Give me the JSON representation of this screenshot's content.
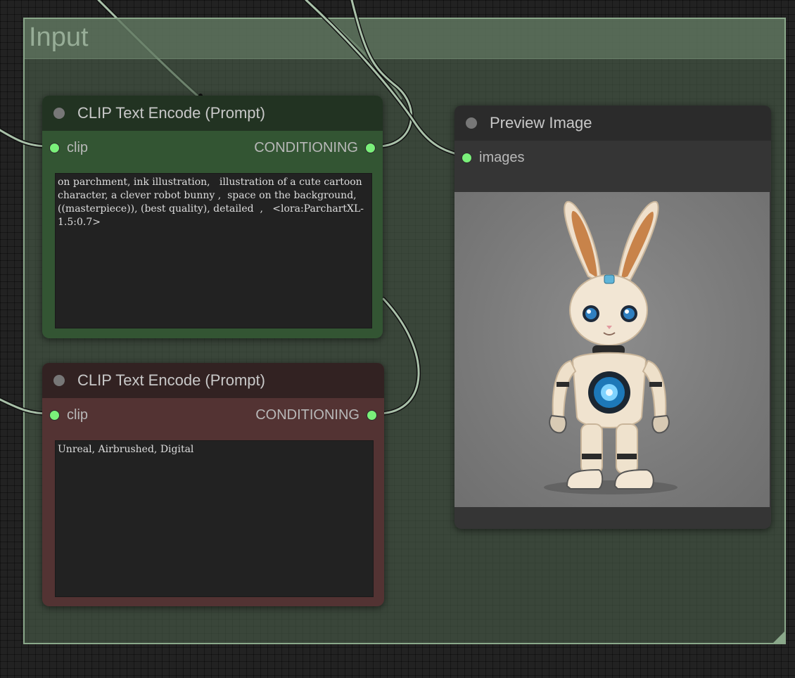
{
  "group": {
    "title": "Input"
  },
  "nodes": {
    "positive": {
      "title": "CLIP Text Encode (Prompt)",
      "input_label": "clip",
      "output_label": "CONDITIONING",
      "text": "on parchment, ink illustration,   illustration of a cute cartoon character, a clever robot bunny ,  space on the background,  ((masterpiece)), (best quality), detailed  ,   <lora:ParchartXL-1.5:0.7>",
      "color": "#335533"
    },
    "negative": {
      "title": "CLIP Text Encode (Prompt)",
      "input_label": "clip",
      "output_label": "CONDITIONING",
      "text": "Unreal, Airbrushed, Digital",
      "color": "#533333"
    },
    "preview": {
      "title": "Preview Image",
      "input_label": "images",
      "image": "robot-bunny-render"
    }
  },
  "colors": {
    "slot": "#7af07a",
    "wire": "#a9c1a9",
    "group_border": "#8aa88a"
  }
}
